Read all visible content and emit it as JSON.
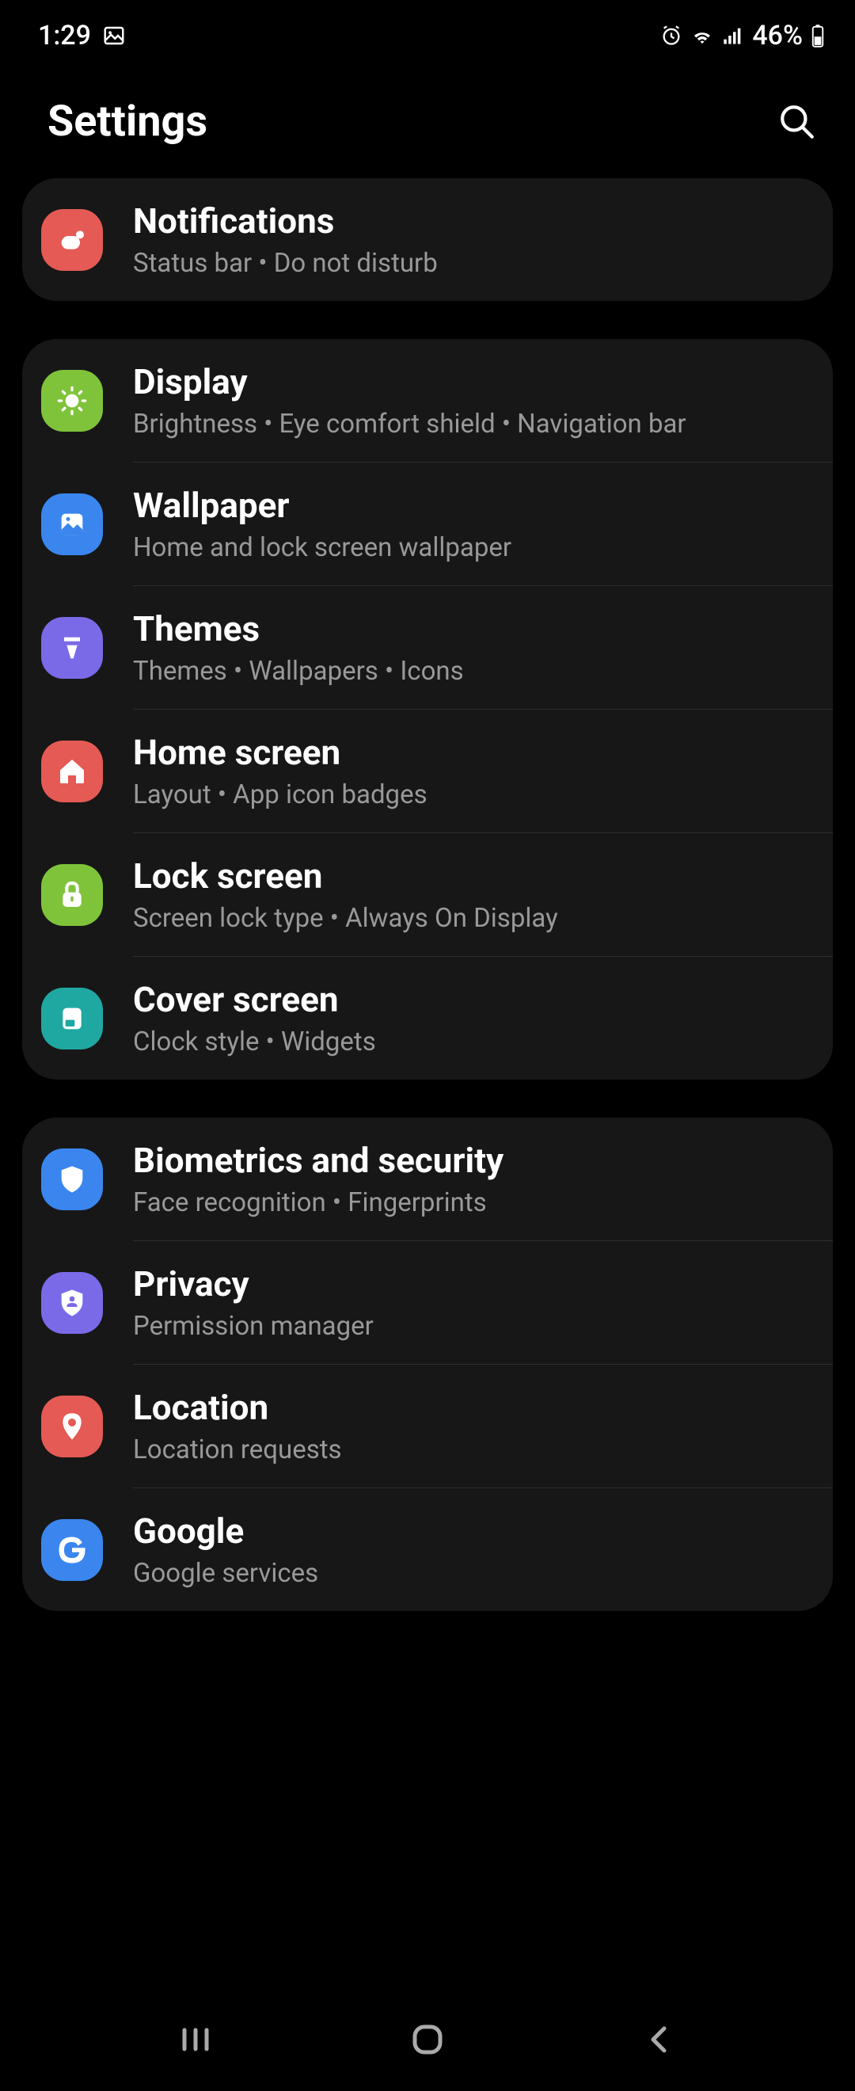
{
  "status_bar": {
    "time": "1:29",
    "battery": "46%"
  },
  "header": {
    "title": "Settings"
  },
  "groups": [
    {
      "rows": [
        {
          "icon": "notifications",
          "icon_bg": "#e55a54",
          "title": "Notifications",
          "sub": "Status bar  •  Do not disturb"
        }
      ]
    },
    {
      "rows": [
        {
          "icon": "display",
          "icon_bg": "#7fc33a",
          "title": "Display",
          "sub": "Brightness  •  Eye comfort shield  •  Navigation bar"
        },
        {
          "icon": "wallpaper",
          "icon_bg": "#3a86ee",
          "title": "Wallpaper",
          "sub": "Home and lock screen wallpaper"
        },
        {
          "icon": "themes",
          "icon_bg": "#7a6ae8",
          "title": "Themes",
          "sub": "Themes  •  Wallpapers  •  Icons"
        },
        {
          "icon": "home",
          "icon_bg": "#e55a54",
          "title": "Home screen",
          "sub": "Layout  •  App icon badges"
        },
        {
          "icon": "lock",
          "icon_bg": "#7fc33a",
          "title": "Lock screen",
          "sub": "Screen lock type  •  Always On Display"
        },
        {
          "icon": "cover",
          "icon_bg": "#1fa8a1",
          "title": "Cover screen",
          "sub": "Clock style  •  Widgets"
        }
      ]
    },
    {
      "rows": [
        {
          "icon": "shield",
          "icon_bg": "#3a86ee",
          "title": "Biometrics and security",
          "sub": "Face recognition  •  Fingerprints"
        },
        {
          "icon": "privacy",
          "icon_bg": "#7a6ae8",
          "title": "Privacy",
          "sub": "Permission manager"
        },
        {
          "icon": "location",
          "icon_bg": "#e55a54",
          "title": "Location",
          "sub": "Location requests"
        },
        {
          "icon": "google",
          "icon_bg": "#3a86ee",
          "title": "Google",
          "sub": "Google services"
        }
      ]
    }
  ]
}
